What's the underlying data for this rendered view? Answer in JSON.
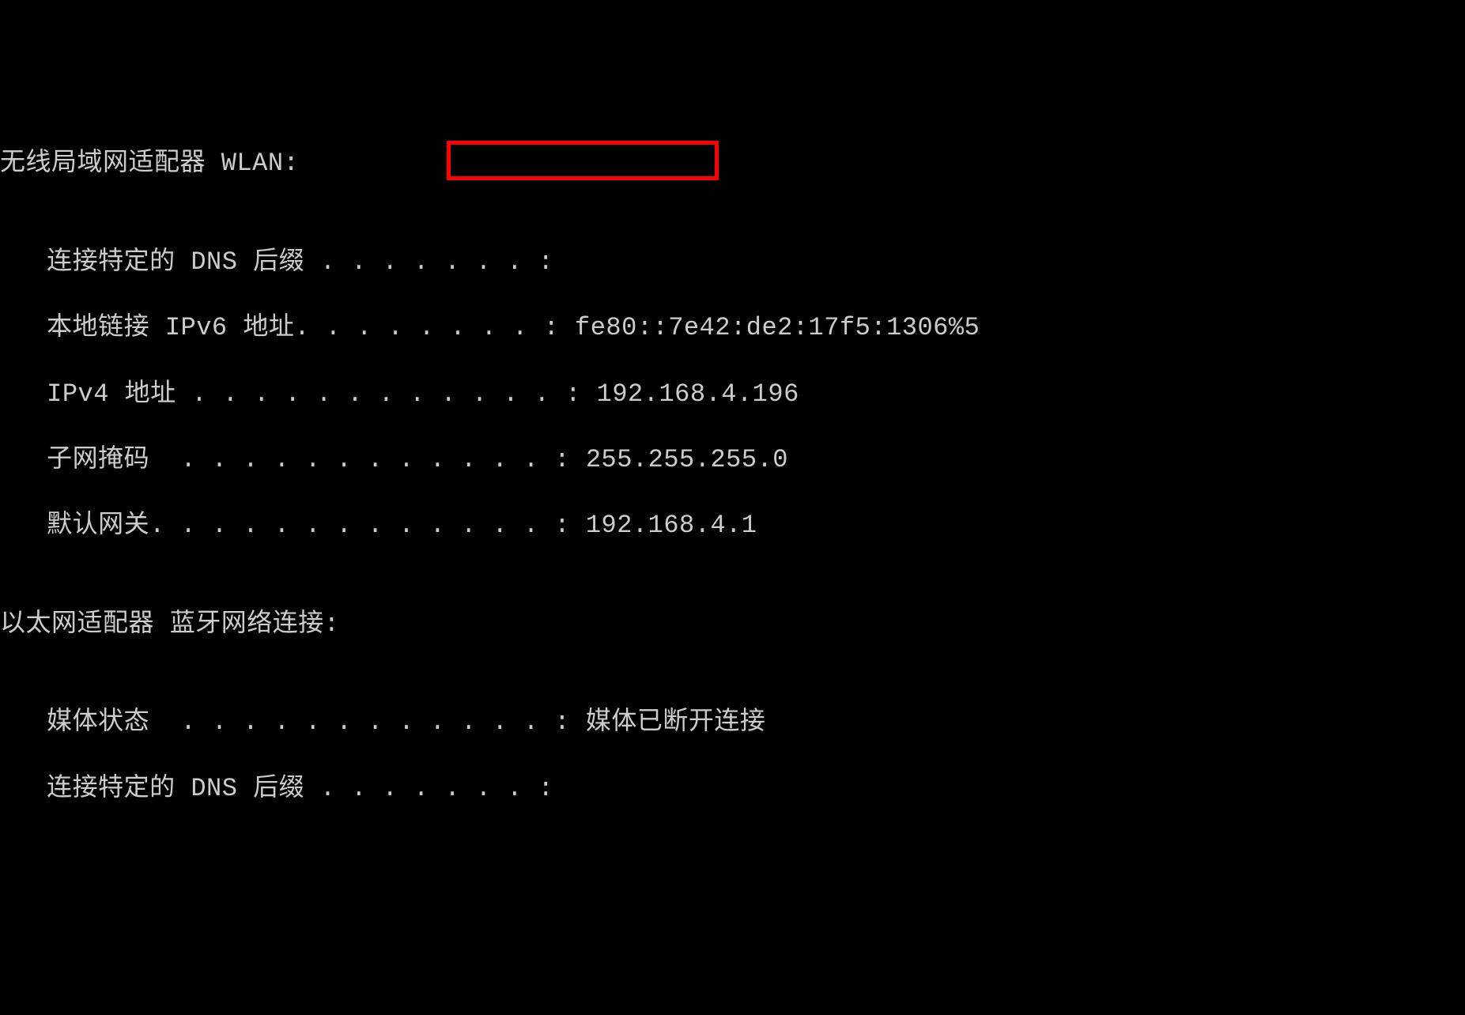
{
  "adapter1": {
    "header": "无线局域网适配器 WLAN:",
    "rows": [
      {
        "label": "   连接特定的 DNS 后缀 . . . . . . . :",
        "value": ""
      },
      {
        "label": "   本地链接 IPv6 地址. . . . . . . . : ",
        "value": "fe80::7e42:de2:17f5:1306%5"
      },
      {
        "label": "   IPv4 地址 . . . . . . . . . . . . : ",
        "value": "192.168.4.196"
      },
      {
        "label": "   子网掩码  . . . . . . . . . . . . : ",
        "value": "255.255.255.0"
      },
      {
        "label": "   默认网关. . . . . . . . . . . . . : ",
        "value": "192.168.4.1"
      }
    ]
  },
  "adapter2": {
    "header": "以太网适配器 蓝牙网络连接:",
    "rows": [
      {
        "label": "   媒体状态  . . . . . . . . . . . . : ",
        "value": "媒体已断开连接"
      },
      {
        "label": "   连接特定的 DNS 后缀 . . . . . . . :",
        "value": ""
      }
    ]
  },
  "highlight_color": "#ff0000"
}
